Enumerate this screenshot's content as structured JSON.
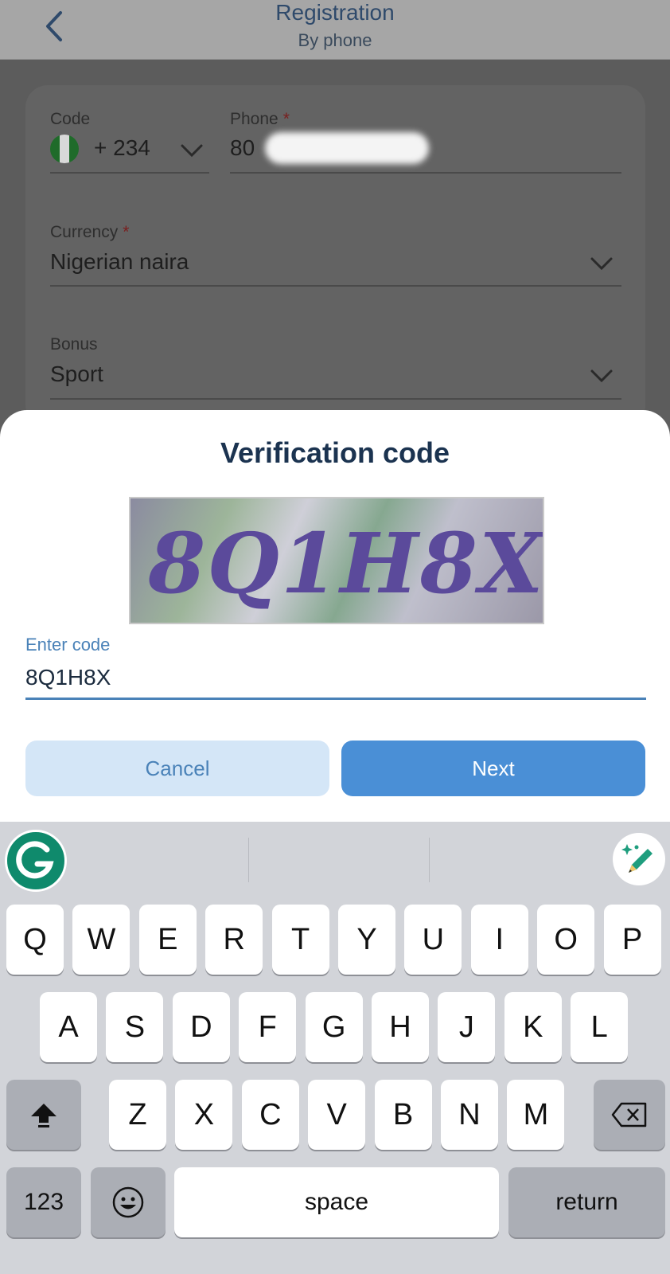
{
  "header": {
    "title": "Registration",
    "subtitle": "By phone"
  },
  "form": {
    "code_label": "Code",
    "code_value": "+ 234",
    "phone_label": "Phone",
    "phone_required": "*",
    "phone_value": "80",
    "currency_label": "Currency",
    "currency_required": "*",
    "currency_value": "Nigerian naira",
    "bonus_label": "Bonus",
    "bonus_value": "Sport"
  },
  "dialog": {
    "title": "Verification code",
    "captcha_text": "8Q1H8X",
    "input_label": "Enter code",
    "input_value": "8Q1H8X",
    "cancel_label": "Cancel",
    "next_label": "Next"
  },
  "keyboard": {
    "row1": [
      "Q",
      "W",
      "E",
      "R",
      "T",
      "Y",
      "U",
      "I",
      "O",
      "P"
    ],
    "row2": [
      "A",
      "S",
      "D",
      "F",
      "G",
      "H",
      "J",
      "K",
      "L"
    ],
    "row3": [
      "Z",
      "X",
      "C",
      "V",
      "B",
      "N",
      "M"
    ],
    "numbers_label": "123",
    "space_label": "space",
    "return_label": "return"
  },
  "colors": {
    "accent": "#4a8fd6",
    "label_blue": "#4a82b8",
    "title_navy": "#1b3350",
    "grammarly_green": "#0f8a6c",
    "flag_green": "#1f6b2a"
  },
  "icons": [
    "back-chevron-icon",
    "chevron-down-icon",
    "nigeria-flag-icon",
    "grammarly-icon",
    "pencil-sparkle-icon",
    "shift-icon",
    "backspace-icon",
    "emoji-icon"
  ]
}
